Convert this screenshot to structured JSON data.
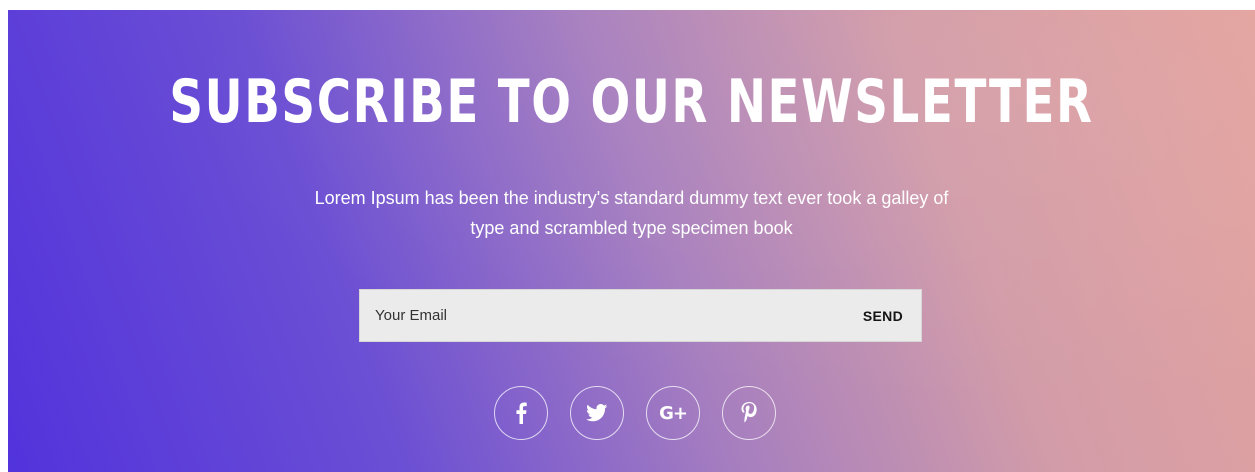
{
  "newsletter": {
    "title": "SUBSCRIBE TO OUR NEWSLETTER",
    "description_line1": "Lorem Ipsum has been the industry's standard dummy text ever took a galley of",
    "description_line2": "type and scrambled type specimen book",
    "email_placeholder": "Your Email",
    "email_value": "",
    "send_label": "SEND"
  },
  "social": [
    {
      "icon": "facebook-icon",
      "glyph": "f"
    },
    {
      "icon": "twitter-icon"
    },
    {
      "icon": "google-plus-icon",
      "glyph": "G+"
    },
    {
      "icon": "pinterest-icon",
      "glyph": "p"
    }
  ],
  "colors": {
    "gradient_start": "#5233dc",
    "gradient_mid": "#a77fbf",
    "gradient_end": "#e4a39e",
    "input_background": "#ebebeb",
    "text_light": "#ffffff"
  }
}
